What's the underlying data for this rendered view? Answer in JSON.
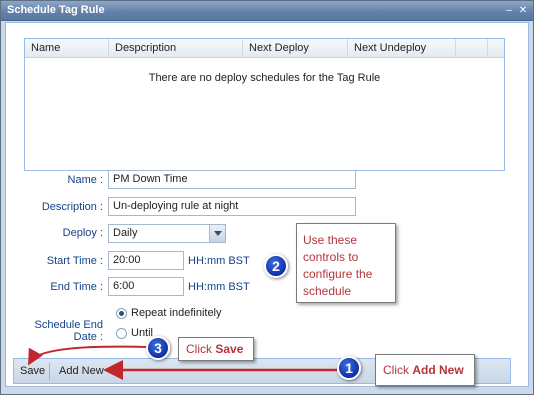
{
  "window": {
    "title": "Schedule Tag Rule",
    "min_icon": "minimize-icon",
    "close_icon": "close-icon"
  },
  "grid": {
    "columns": [
      "Name",
      "Despcription",
      "Next Deploy",
      "Next Undeploy"
    ],
    "empty_text": "There are no deploy schedules for the Tag Rule"
  },
  "form": {
    "name_label": "Name :",
    "name_value": "PM Down Time",
    "description_label": "Description :",
    "description_value": "Un-deploying rule at night",
    "deploy_label": "Deploy :",
    "deploy_value": "Daily",
    "start_label": "Start Time :",
    "start_value": "20:00",
    "end_label": "End Time :",
    "end_value": "6:00",
    "time_hint": "HH:mm BST",
    "end_date_label": "Schedule End Date :",
    "repeat_label": "Repeat indefinitely",
    "until_label": "Until"
  },
  "toolbar": {
    "save_label": "Save",
    "add_new_label": "Add New"
  },
  "annotations": {
    "controls_note": "Use these controls to configure the schedule",
    "badge_1": "1",
    "badge_2": "2",
    "badge_3": "3",
    "click_prefix": "Click",
    "save_word": "Save",
    "add_new_word": "Add New"
  },
  "colors": {
    "callout_text": "#b5343b",
    "arrow": "#c0282e",
    "badge": "#1a3fb5"
  }
}
